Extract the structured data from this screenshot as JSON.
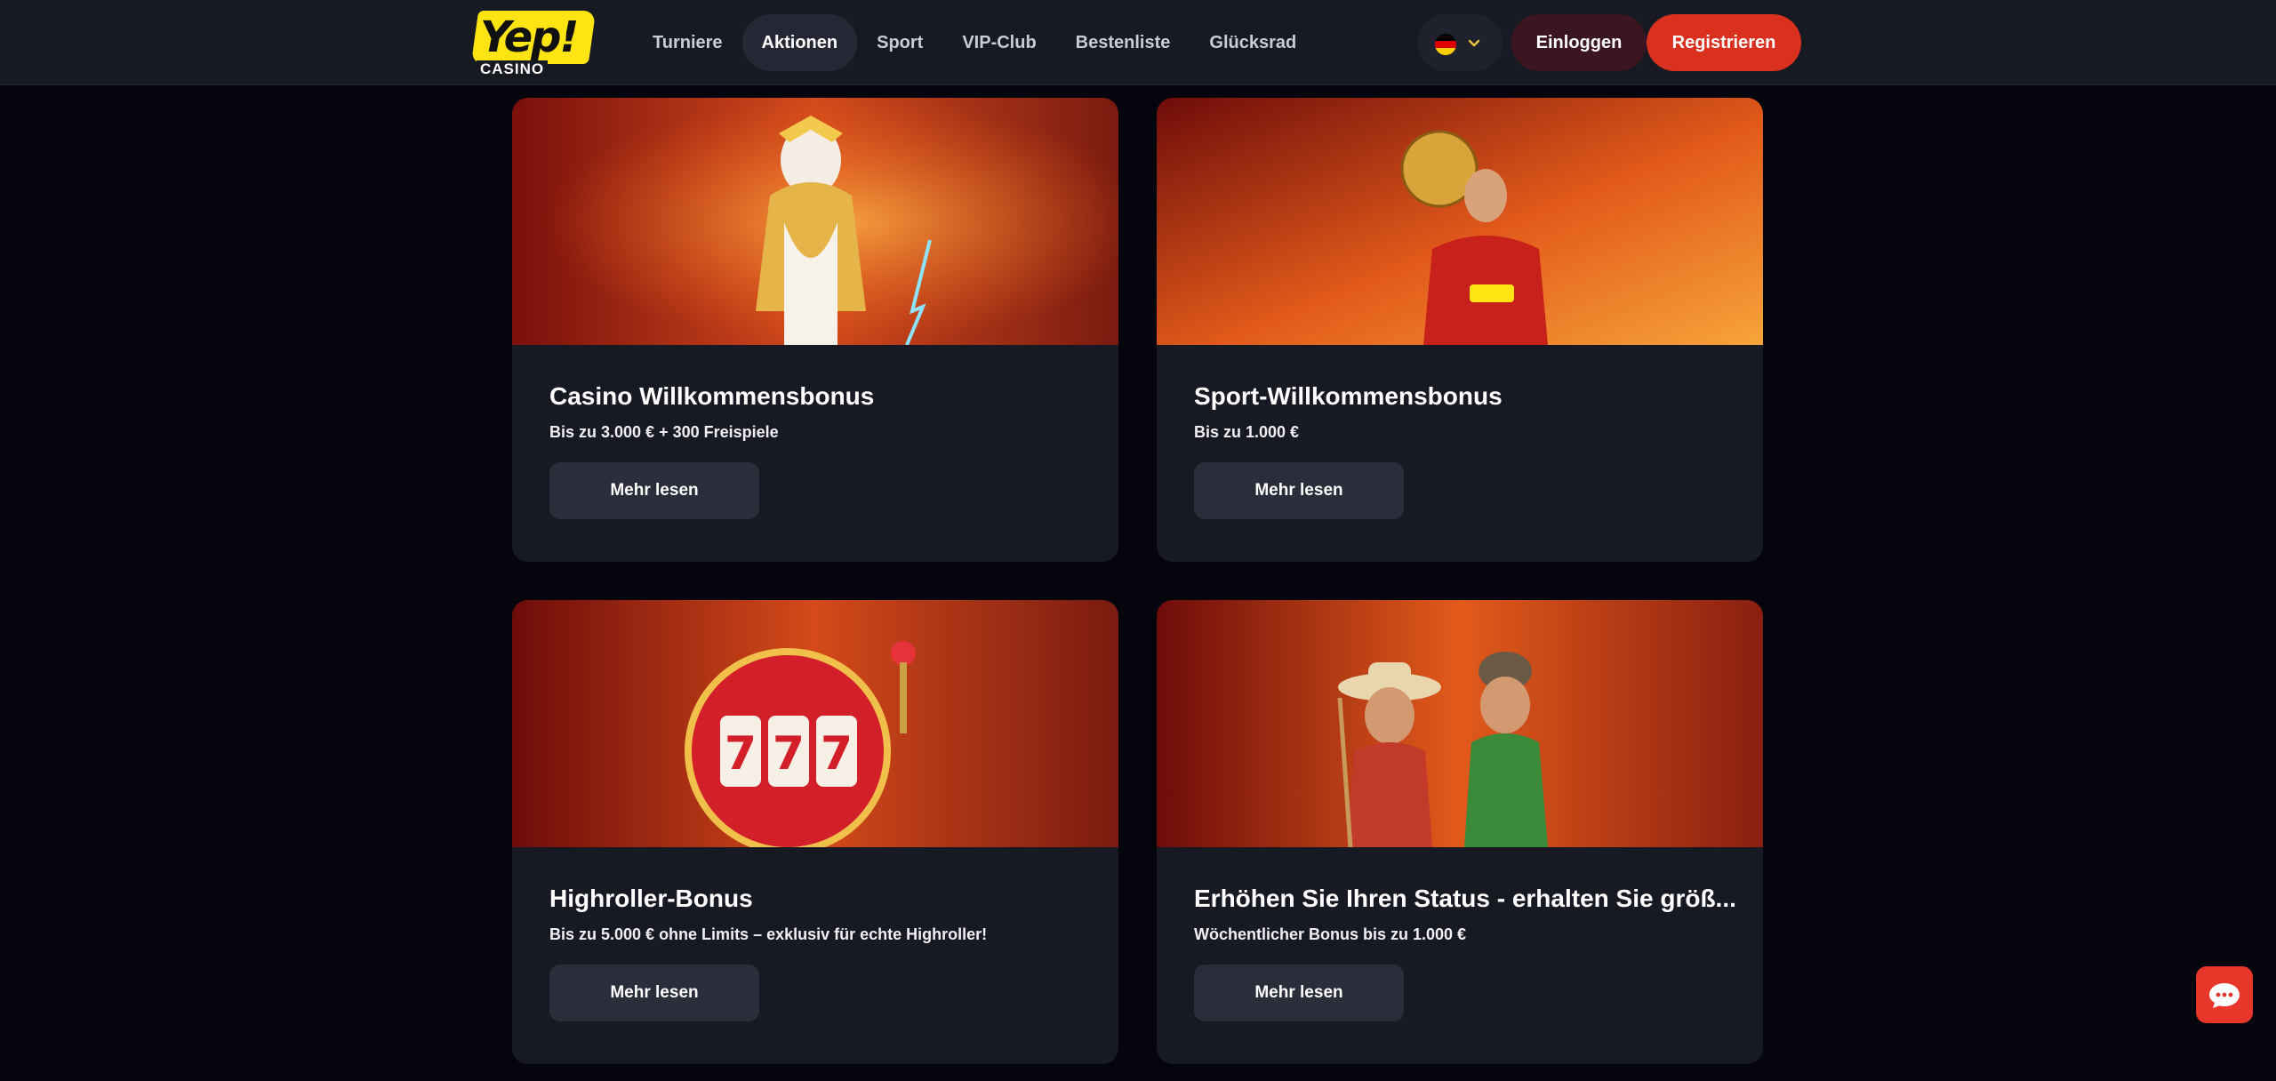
{
  "brand": {
    "logo_main": "Yep!",
    "logo_sub": "CASINO"
  },
  "nav": {
    "items": [
      {
        "label": "Turniere",
        "active": false
      },
      {
        "label": "Aktionen",
        "active": true
      },
      {
        "label": "Sport",
        "active": false
      },
      {
        "label": "VIP-Club",
        "active": false
      },
      {
        "label": "Bestenliste",
        "active": false
      },
      {
        "label": "Glücksrad",
        "active": false
      }
    ],
    "language_icon": "flag-germany-icon",
    "login_label": "Einloggen",
    "register_label": "Registrieren"
  },
  "promotions": [
    {
      "title": "Casino Willkommensbonus",
      "subtitle": "Bis zu 3.000 € + 300 Freispiele",
      "button": "Mehr lesen",
      "image": "zeus-illustration"
    },
    {
      "title": "Sport-Willkommensbonus",
      "subtitle": "Bis zu 1.000 €",
      "button": "Mehr lesen",
      "image": "football-player-illustration"
    },
    {
      "title": "Highroller-Bonus",
      "subtitle": "Bis zu 5.000 € ohne Limits – exklusiv für echte Highroller!",
      "button": "Mehr lesen",
      "image": "slot-machine-777-illustration"
    },
    {
      "title": "Erhöhen Sie Ihren Status - erhalten Sie größ...",
      "subtitle": "Wöchentlicher Bonus bis zu 1.000 €",
      "button": "Mehr lesen",
      "image": "fishermen-illustration"
    }
  ],
  "colors": {
    "accent": "#d9301f",
    "logo_yellow": "#ffe414",
    "card_bg": "#181a23",
    "page_bg": "#05060d"
  },
  "chat": {
    "icon": "chat-bubble-icon"
  }
}
